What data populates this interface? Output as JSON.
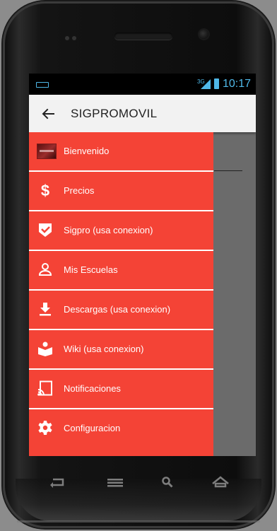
{
  "status_bar": {
    "network": "3G",
    "time": "10:17",
    "accent_color": "#4fb8e8"
  },
  "app_bar": {
    "back_icon": "arrow-back-icon",
    "title": "SIGPROMOVIL",
    "background": "#f2f2f2"
  },
  "drawer": {
    "background": "#f44336",
    "items": [
      {
        "label": "Bienvenido",
        "icon": "avatar-image"
      },
      {
        "label": "Precios",
        "icon": "dollar-icon"
      },
      {
        "label": "Sigpro (usa conexion)",
        "icon": "shield-check-icon"
      },
      {
        "label": "Mis Escuelas",
        "icon": "person-icon"
      },
      {
        "label": "Descargas (usa conexion)",
        "icon": "download-icon"
      },
      {
        "label": "Wiki (usa conexion)",
        "icon": "book-reader-icon"
      },
      {
        "label": "Notificaciones",
        "icon": "cast-icon"
      },
      {
        "label": "Configuracion",
        "icon": "gear-icon"
      }
    ]
  },
  "nav_buttons": [
    "back-nav-icon",
    "menu-nav-icon",
    "search-nav-icon",
    "home-nav-icon"
  ]
}
